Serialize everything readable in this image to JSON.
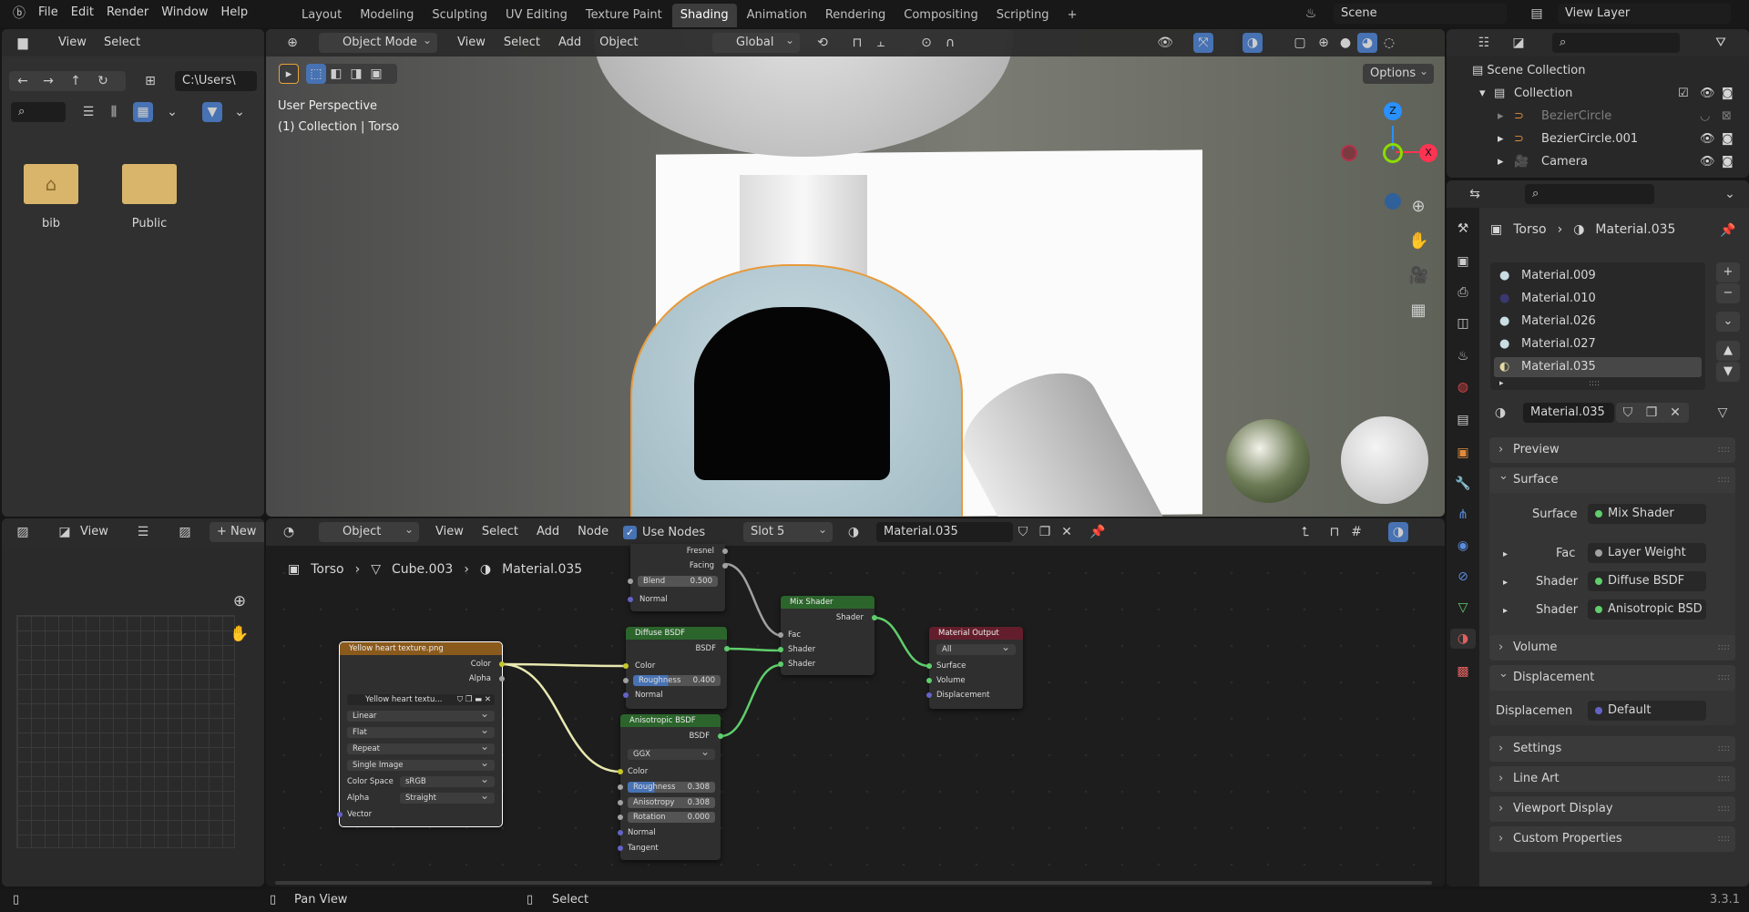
{
  "topbar": {
    "menus": [
      "File",
      "Edit",
      "Render",
      "Window",
      "Help"
    ],
    "workspaces": [
      "Layout",
      "Modeling",
      "Sculpting",
      "UV Editing",
      "Texture Paint",
      "Shading",
      "Animation",
      "Rendering",
      "Compositing",
      "Scripting"
    ],
    "active_workspace": "Shading",
    "add_tab": "+",
    "scene": "Scene",
    "view_layer": "View Layer"
  },
  "file_browser": {
    "menus": [
      "View",
      "Select"
    ],
    "path": "C:\\Users\\",
    "folders": [
      {
        "name": "bib",
        "icon": "home-folder-icon"
      },
      {
        "name": "Public",
        "icon": "folder-icon"
      }
    ]
  },
  "viewport": {
    "mode": "Object Mode",
    "menus": [
      "View",
      "Select",
      "Add",
      "Object"
    ],
    "orientation": "Global",
    "options": "Options",
    "overlay_title": "User Perspective",
    "overlay_subtitle": "(1) Collection | Torso",
    "gizmo": {
      "z": "Z",
      "x": "X",
      "y": "Y"
    },
    "colors": {
      "x": "#ff3352",
      "y": "#8bdc00",
      "z": "#2890ff"
    }
  },
  "image_editor": {
    "view": "View",
    "new": "New"
  },
  "node_editor": {
    "object": "Object",
    "menus": [
      "View",
      "Select",
      "Add",
      "Node"
    ],
    "use_nodes": "Use Nodes",
    "use_nodes_checked": true,
    "slot": "Slot 5",
    "material": "Material.035",
    "breadcrumb": [
      "Torso",
      "Cube.003",
      "Material.035"
    ],
    "nodes": {
      "layer_weight": {
        "outputs": [
          "Fresnel",
          "Facing"
        ],
        "blend_label": "Blend",
        "blend": "0.500",
        "normal": "Normal"
      },
      "image": {
        "title": "Yellow heart texture.png",
        "outputs": [
          "Color",
          "Alpha"
        ],
        "image": "Yellow heart textu...",
        "interpolation": "Linear",
        "projection": "Flat",
        "extension": "Repeat",
        "source": "Single Image",
        "color_space_label": "Color Space",
        "color_space": "sRGB",
        "alpha_label": "Alpha",
        "alpha": "Straight",
        "vector": "Vector",
        "color": "#8a5a1c"
      },
      "diffuse": {
        "title": "Diffuse BSDF",
        "output": "BSDF",
        "color": "Color",
        "roughness_label": "Roughness",
        "roughness": "0.400",
        "roughness_fraction": 0.4,
        "normal": "Normal"
      },
      "anisotropic": {
        "title": "Anisotropic BSDF",
        "output": "BSDF",
        "distribution": "GGX",
        "color": "Color",
        "roughness_label": "Roughness",
        "roughness": "0.308",
        "roughness_fraction": 0.308,
        "anisotropy_label": "Anisotropy",
        "anisotropy": "0.308",
        "rotation_label": "Rotation",
        "rotation": "0.000",
        "normal": "Normal",
        "tangent": "Tangent"
      },
      "mix": {
        "title": "Mix Shader",
        "output": "Shader",
        "inputs": [
          "Fac",
          "Shader",
          "Shader"
        ]
      },
      "output": {
        "title": "Material Output",
        "target": "All",
        "inputs": [
          "Surface",
          "Volume",
          "Displacement"
        ]
      }
    }
  },
  "outliner": {
    "rows": [
      {
        "name": "Scene Collection"
      },
      {
        "name": "Collection"
      },
      {
        "name": "BezierCircle",
        "dimmed": true
      },
      {
        "name": "BezierCircle.001"
      },
      {
        "name": "Camera"
      }
    ]
  },
  "properties": {
    "breadcrumb": [
      "Torso",
      "Material.035"
    ],
    "materials": [
      "Material.009",
      "Material.010",
      "Material.026",
      "Material.027",
      "Material.035"
    ],
    "selected_material": "Material.035",
    "material_field": "Material.035",
    "panels": {
      "preview": "Preview",
      "surface": "Surface",
      "volume": "Volume",
      "displacement": "Displacement",
      "settings": "Settings",
      "line_art": "Line Art",
      "viewport_display": "Viewport Display",
      "custom_properties": "Custom Properties"
    },
    "surface": {
      "label": "Surface",
      "value": "Mix Shader",
      "inputs": [
        {
          "label": "Fac",
          "value": "Layer Weight"
        },
        {
          "label": "Shader",
          "value": "Diffuse BSDF"
        },
        {
          "label": "Shader",
          "value": "Anisotropic BSD"
        }
      ]
    },
    "displacement": {
      "label": "Displacemen",
      "value": "Default"
    }
  },
  "statusbar": {
    "left": "Pan View",
    "middle": "Select",
    "version": "3.3.1"
  },
  "colors": {
    "accent": "#4772b3",
    "shader_socket": "#5fce6b",
    "color_socket": "#c7c729",
    "vector_socket": "#6363c7",
    "shader_header": "#2b652b",
    "output_header": "#641e2b"
  }
}
